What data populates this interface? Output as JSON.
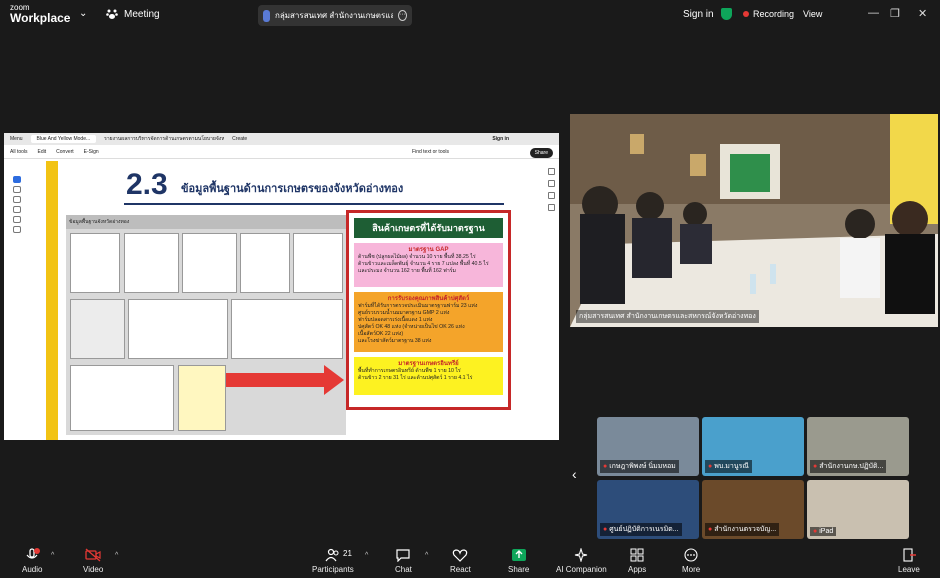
{
  "app": {
    "logo_top": "zoom",
    "logo_bottom": "Workplace",
    "meeting_label": "Meeting",
    "sign_in": "Sign in",
    "recording": "Recording",
    "view": "View"
  },
  "meeting_title": "กลุ่มสารสนเทศ สำนักงานเกษตรและสหกรณ์จังหวัดอ่างทอง",
  "shared_screen": {
    "menu": "Menu",
    "tab1": "Blue And Yellow Mode...",
    "tab2": "รายงานผลการบริหารจัดการด้านเกษตรตามนโยบายจังหวัด",
    "create": "Create",
    "sign_in": "Sign in",
    "tools": [
      "All tools",
      "Edit",
      "Convert",
      "E-Sign"
    ],
    "find": "Find text or tools",
    "share": "Share",
    "slide_number": "2.3",
    "slide_title": "ข้อมูลพื้นฐานด้านการเกษตรของจังหวัดอ่างทอง",
    "infographic_title": "ข้อมูลพื้นฐานจังหวัดอ่างทอง",
    "panel_title": "สินค้าเกษตรที่ได้รับมาตรฐาน",
    "card1": {
      "heading": "มาตรฐาน GAP",
      "lines": [
        "ด้านพืช (ปลูกผลไม้ผล) จำนวน 10 ราย พื้นที่ 38.25 ไร่",
        "ด้านข้าวและเมล็ดพันธุ์ จำนวน 4 ราย 7 แปลง พื้นที่ 40.5 ไร่",
        "และประมง จำนวน 162 ราย พื้นที่ 162 ฟาร์ม"
      ]
    },
    "card2": {
      "heading": "การรับรองคุณภาพสินค้าปศุสัตว์",
      "lines": [
        "ฟาร์มที่ได้รับการตรวจประเมินมาตรฐานฟาร์ม 23 แห่ง",
        "ศูนย์รวบรวมน้ำนมมาตรฐาน GMP 2 แห่ง",
        "ฟาร์มปลอดสารเร่งเนื้อแดง 1 แห่ง",
        "ปศุสัตว์ OK 48 แห่ง (จำหน่ายเป็นไข่ OK 26 แห่ง",
        "เนื้อสัตว์OK 22 แห่ง)",
        "และโรงฆ่าสัตว์มาตรฐาน 38 แห่ง"
      ]
    },
    "card3": {
      "heading": "มาตรฐานเกษตรอินทรีย์",
      "lines": [
        "พื้นที่ทำการเกษตรอินทรีย์ ด้านพืช 1 ราย 10 ไร่",
        "ด้านข้าว 2 ราย 31 ไร่ และด้านปศุสัตว์ 1 ราย 4.1 ไร่"
      ]
    }
  },
  "main_camera_label": "กลุ่มสารสนเทศ สำนักงานเกษตรและสหกรณ์จังหวัดอ่างทอง",
  "gallery": [
    {
      "name": "เกษฎาพิพงษ์ นิ่มมหอม"
    },
    {
      "name": "พบ.มานูรณี"
    },
    {
      "name": "สำนักงานกษ.ปฏิบัติ..."
    },
    {
      "name": "ศูนย์ปฏิบัติการเนรมิต..."
    },
    {
      "name": "สำนักงานตรวจบัญ..."
    },
    {
      "name": "iPad"
    }
  ],
  "toolbar": {
    "audio": "Audio",
    "video": "Video",
    "participants": "Participants",
    "participants_count": "21",
    "chat": "Chat",
    "react": "React",
    "share": "Share",
    "ai": "AI Companion",
    "apps": "Apps",
    "more": "More",
    "leave": "Leave"
  },
  "colors": {
    "share_green": "#0ea55a",
    "leave_red": "#e53935",
    "panel_green": "#1e5e34"
  }
}
